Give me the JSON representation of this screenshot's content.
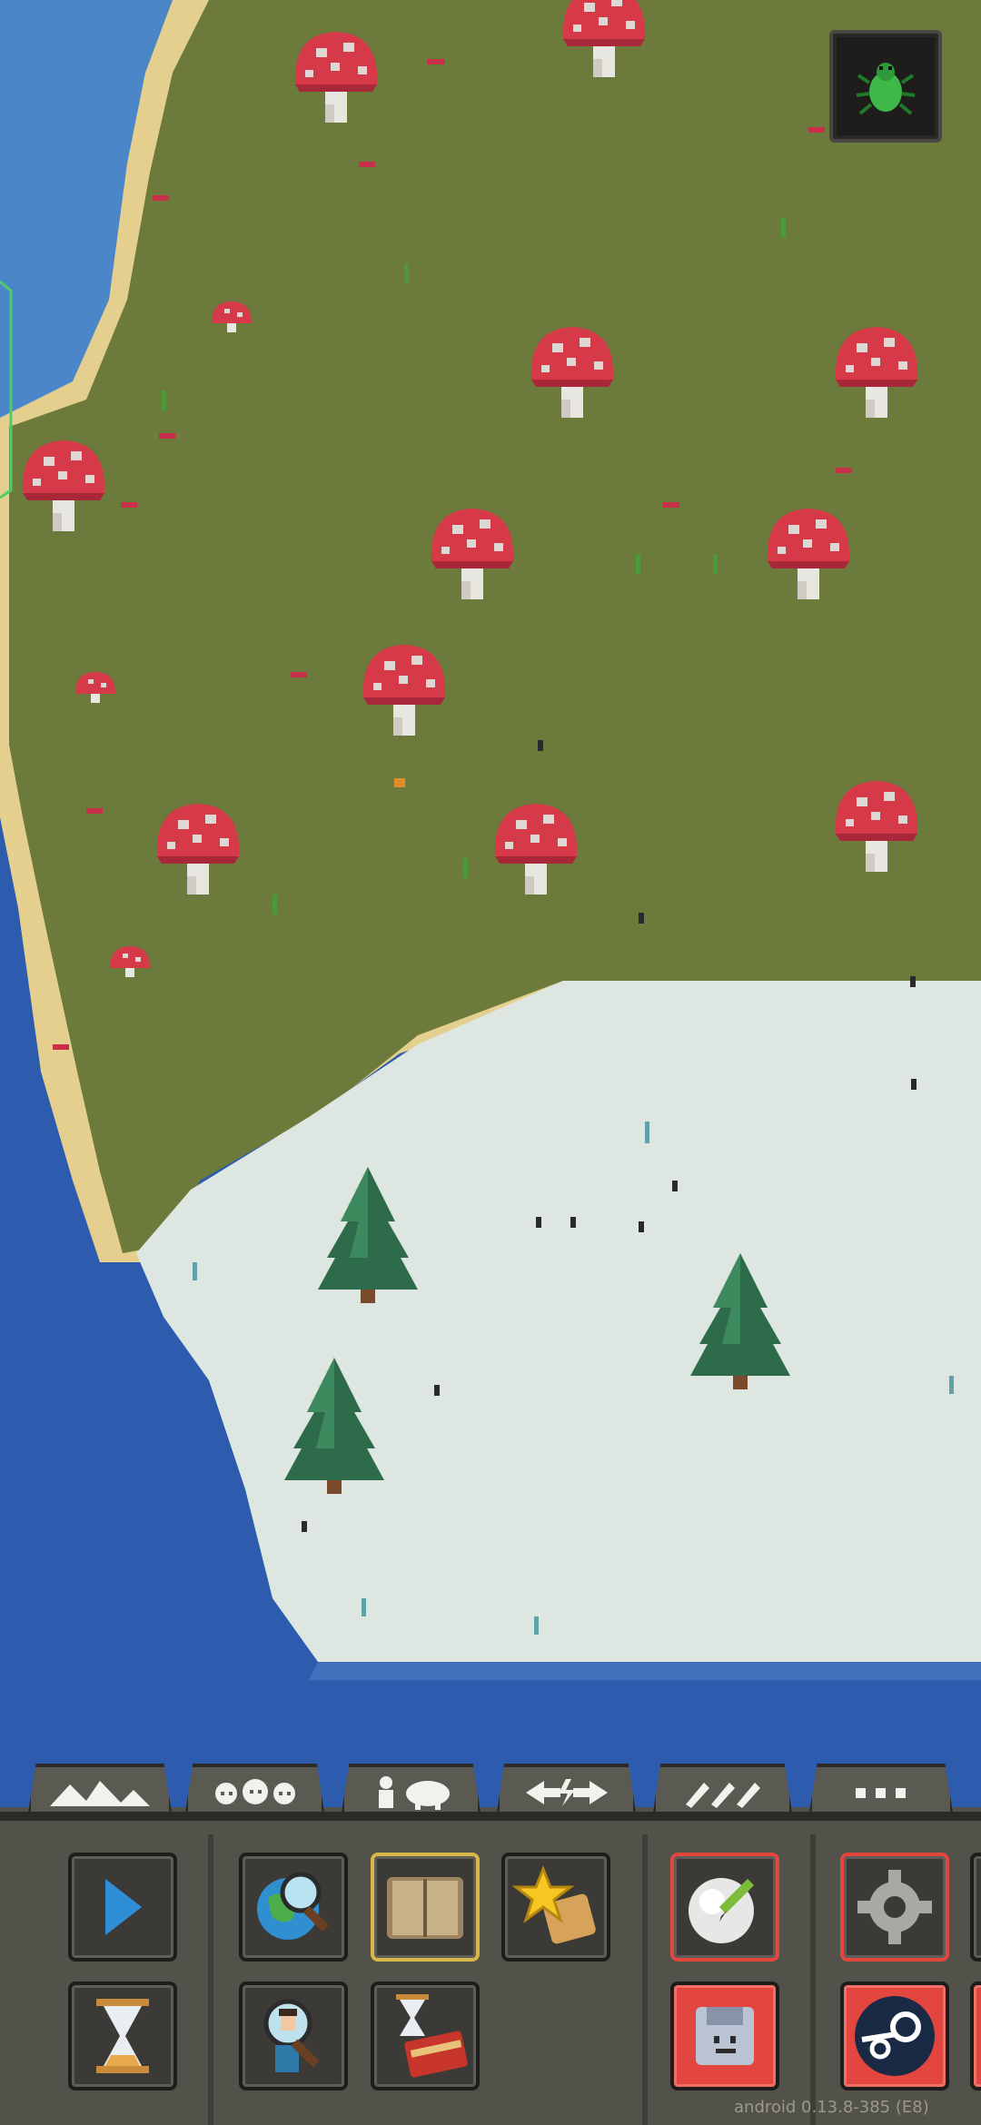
{
  "top_button": {
    "icon": "green-bug-icon"
  },
  "tabs": [
    {
      "id": "terrain",
      "icon": "mountains-icon"
    },
    {
      "id": "civilizations",
      "icon": "kingdom-heads-icon"
    },
    {
      "id": "creatures",
      "icon": "human-sheep-icon"
    },
    {
      "id": "powers",
      "icon": "lightning-swap-icon"
    },
    {
      "id": "tools",
      "icon": "brushes-icon"
    },
    {
      "id": "more",
      "icon": "ellipsis-icon"
    }
  ],
  "toolbar_buttons": [
    {
      "id": "play",
      "icon": "play-icon"
    },
    {
      "id": "time",
      "icon": "hourglass-icon"
    },
    {
      "id": "world_info",
      "icon": "globe-magnifier-icon"
    },
    {
      "id": "unit_search",
      "icon": "person-magnifier-icon"
    },
    {
      "id": "world_laws",
      "icon": "open-book-icon"
    },
    {
      "id": "history",
      "icon": "hourglass-book-icon"
    },
    {
      "id": "favorites",
      "icon": "star-scroll-icon"
    },
    {
      "id": "world_editor",
      "icon": "pencil-sphere-icon"
    },
    {
      "id": "save",
      "icon": "floppy-face-icon"
    },
    {
      "id": "settings",
      "icon": "gear-icon"
    },
    {
      "id": "steam",
      "icon": "steam-icon"
    }
  ],
  "colors": {
    "ocean": "#2d5cae",
    "shallow_water": "#4b87c8",
    "sand": "#e4cf8e",
    "grass": "#6c7a3b",
    "snow": "#dde6e1",
    "toolbar": "#52514a",
    "accent_red": "#e2463f",
    "play_blue": "#2e8fd6"
  },
  "version_text": "android 0.13.8-385 (E8)"
}
